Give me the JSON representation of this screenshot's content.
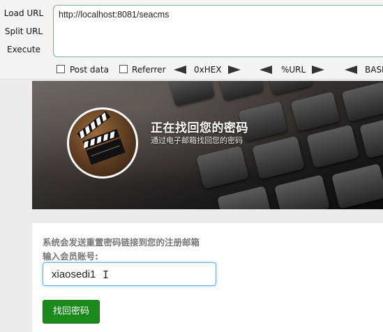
{
  "hackbar": {
    "load_url": "Load URL",
    "split_url": "Split URL",
    "execute": "Execute",
    "url_value": "http://localhost:8081/seacms",
    "options": {
      "post_data": "Post data",
      "referrer": "Referrer",
      "hex": "0xHEX",
      "url_encode": "%URL",
      "base64": "BASE"
    }
  },
  "banner": {
    "title": "正在找回您的密码",
    "subtitle": "通过电子邮箱找回您的密码"
  },
  "form": {
    "notice": "系统会发送重置密码链接到您的注册邮箱",
    "account_label": "输入会员账号:",
    "account_value": "xiaosedi1",
    "submit_label": "找回密码"
  },
  "colors": {
    "submit_green": "#1a8a1a",
    "input_focus_blue": "#66afe9",
    "url_border_green": "#7bb77b"
  }
}
